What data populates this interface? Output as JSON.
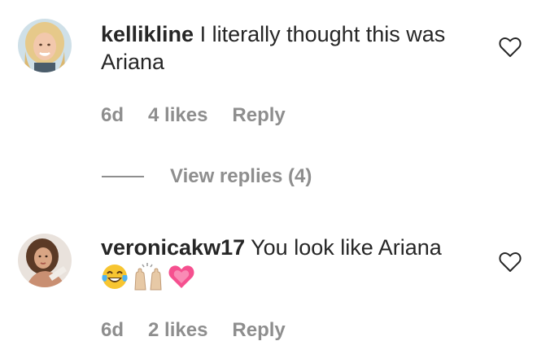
{
  "comments": [
    {
      "username": "kellikline",
      "text_line1": "I literally thought this was",
      "text_line2": "Ariana",
      "time": "6d",
      "likes": "4 likes",
      "reply": "Reply",
      "avatar_icon": "avatar-photo-blonde-woman",
      "view_replies": "View replies (4)"
    },
    {
      "username": "veronicakw17",
      "text": "You look like Ariana",
      "emojis": [
        "face-with-tears-of-joy",
        "raising-hands-light-skin",
        "growing-heart"
      ],
      "time": "6d",
      "likes": "2 likes",
      "reply": "Reply",
      "avatar_icon": "avatar-photo-brunette-woman"
    }
  ],
  "colors": {
    "text": "#262626",
    "secondary": "#8e8e8e",
    "background": "#ffffff"
  }
}
